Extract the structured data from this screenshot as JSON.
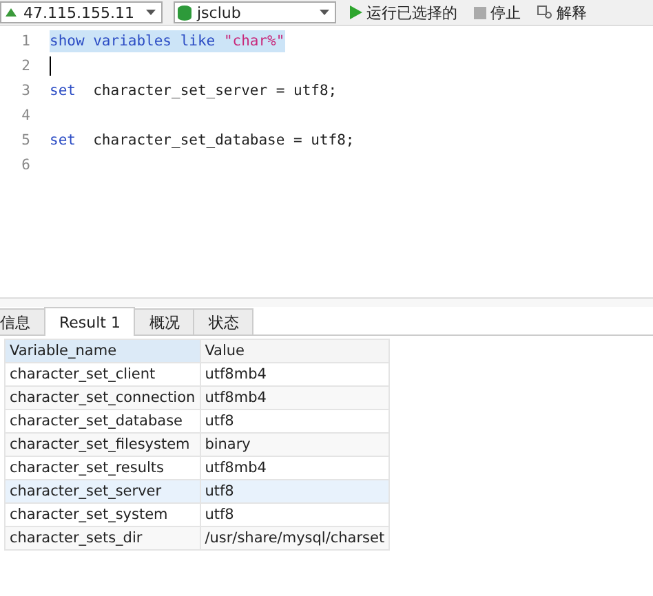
{
  "toolbar": {
    "connection": "47.115.155.11",
    "database": "jsclub",
    "buttons": [
      {
        "label": "运行已选择的",
        "kind": "run"
      },
      {
        "label": "停止",
        "kind": "stop"
      },
      {
        "label": "解释",
        "kind": "explain"
      }
    ]
  },
  "editor": {
    "lines": [
      {
        "number": "1",
        "selected": true,
        "cursor": false,
        "tokens": [
          {
            "text": "show variables like ",
            "kind": "keyword"
          },
          {
            "text": "\"char%\"",
            "kind": "string"
          }
        ]
      },
      {
        "number": "2",
        "selected": false,
        "cursor": true
      },
      {
        "number": "3",
        "selected": false,
        "cursor": false,
        "tokens": [
          {
            "text": "set",
            "kind": "keyword"
          },
          {
            "text": "  character_set_server = utf8;",
            "kind": "plain"
          }
        ]
      },
      {
        "number": "4",
        "selected": false,
        "cursor": false
      },
      {
        "number": "5",
        "selected": false,
        "cursor": false,
        "tokens": [
          {
            "text": "set",
            "kind": "keyword"
          },
          {
            "text": "  character_set_database = utf8;",
            "kind": "plain"
          }
        ]
      },
      {
        "number": "6",
        "selected": false,
        "cursor": false
      }
    ]
  },
  "tabs": [
    {
      "label": "信息",
      "selected": false
    },
    {
      "label": "Result 1",
      "selected": true
    },
    {
      "label": "概况",
      "selected": false
    },
    {
      "label": "状态",
      "selected": false
    }
  ],
  "table": {
    "columns": [
      "Variable_name",
      "Value"
    ],
    "rows": [
      {
        "cells": [
          "character_set_client",
          "utf8mb4"
        ],
        "selected": false
      },
      {
        "cells": [
          "character_set_connection",
          "utf8mb4"
        ],
        "selected": false
      },
      {
        "cells": [
          "character_set_database",
          "utf8"
        ],
        "selected": false
      },
      {
        "cells": [
          "character_set_filesystem",
          "binary"
        ],
        "selected": false
      },
      {
        "cells": [
          "character_set_results",
          "utf8mb4"
        ],
        "selected": false
      },
      {
        "cells": [
          "character_set_server",
          "utf8"
        ],
        "selected": true
      },
      {
        "cells": [
          "character_set_system",
          "utf8"
        ],
        "selected": false
      },
      {
        "cells": [
          "character_sets_dir",
          "/usr/share/mysql/charset"
        ],
        "selected": false
      }
    ]
  }
}
